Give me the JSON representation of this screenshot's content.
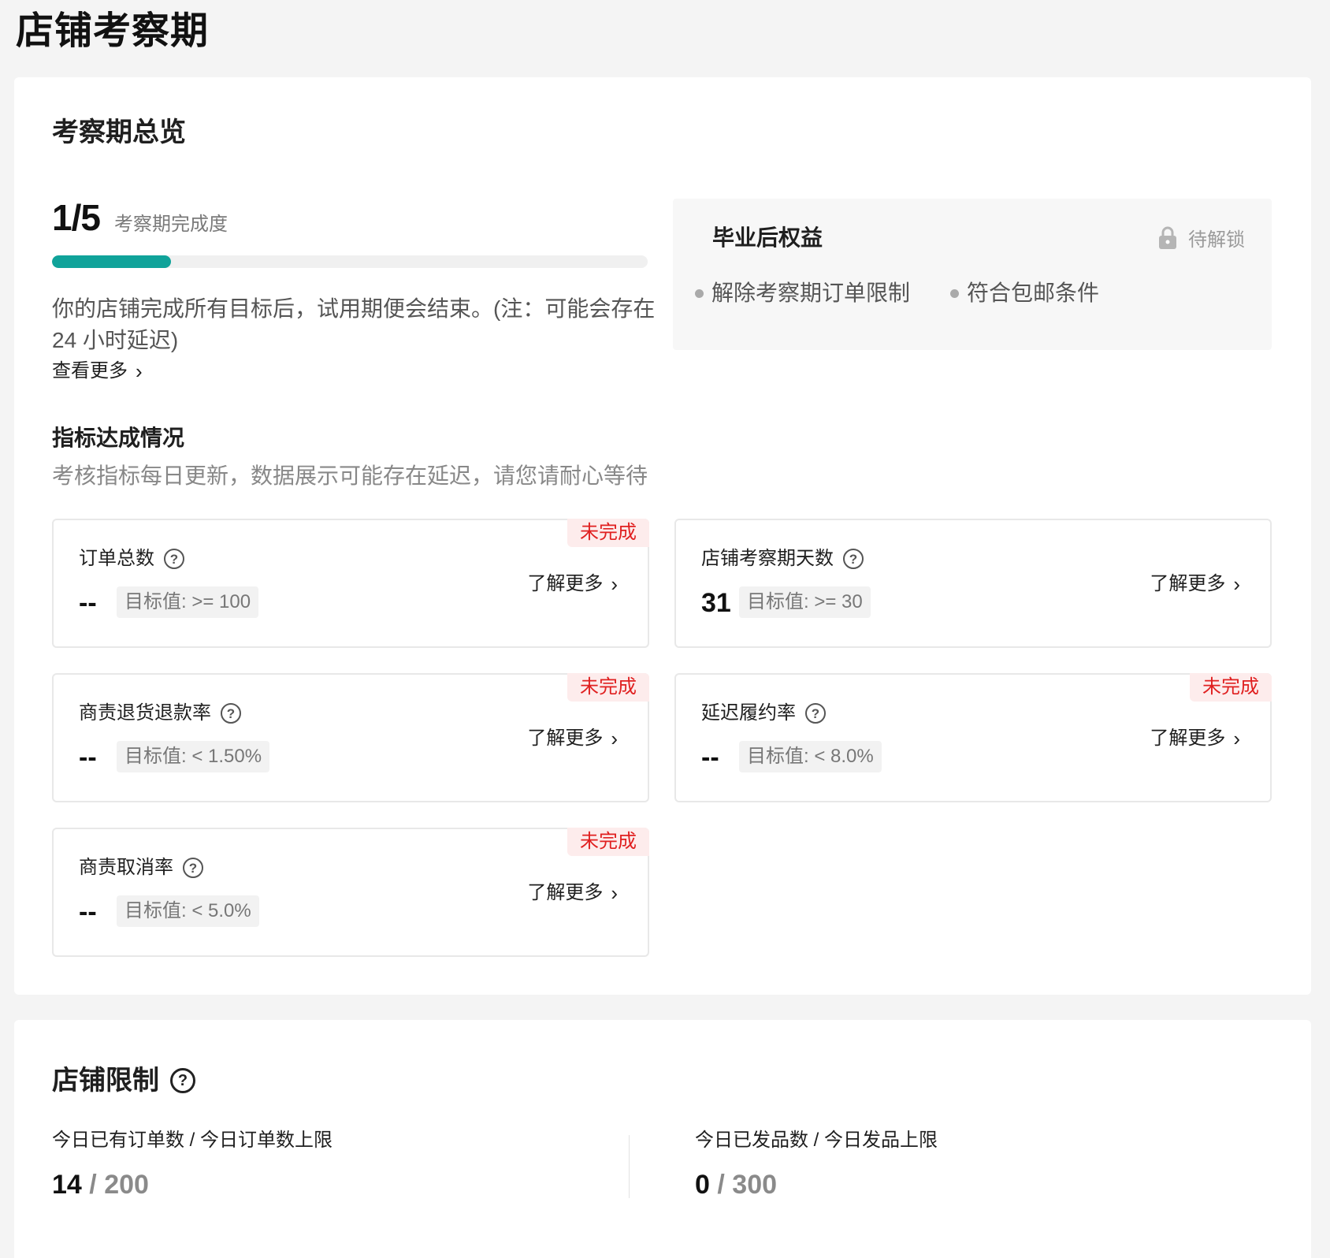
{
  "page": {
    "title": "店铺考察期"
  },
  "overview": {
    "section_title": "考察期总览",
    "progress": {
      "value_text": "1/5",
      "label": "考察期完成度",
      "completed": 1,
      "total": 5,
      "fill_color": "#10a39a"
    },
    "note": "你的店铺完成所有目标后，试用期便会结束。(注：可能会存在 24 小时延迟)",
    "see_more": "查看更多",
    "benefits": {
      "title": "毕业后权益",
      "lock_label": "待解锁",
      "items": [
        "解除考察期订单限制",
        "符合包邮条件"
      ]
    }
  },
  "metrics": {
    "title": "指标达成情况",
    "subtitle": "考核指标每日更新，数据展示可能存在延迟，请您请耐心等待",
    "learn_more": "了解更多",
    "badge_incomplete": "未完成",
    "items": [
      {
        "name": "订单总数",
        "value": "--",
        "target": "目标值: >= 100",
        "incomplete": true
      },
      {
        "name": "店铺考察期天数",
        "value": "31",
        "target": "目标值: >= 30",
        "incomplete": false
      },
      {
        "name": "商责退货退款率",
        "value": "--",
        "target": "目标值: < 1.50%",
        "incomplete": true
      },
      {
        "name": "延迟履约率",
        "value": "--",
        "target": "目标值: < 8.0%",
        "incomplete": true
      },
      {
        "name": "商责取消率",
        "value": "--",
        "target": "目标值: < 5.0%",
        "incomplete": true
      }
    ]
  },
  "limits": {
    "title": "店铺限制",
    "orders": {
      "label": "今日已有订单数 / 今日订单数上限",
      "current": "14",
      "separator": "/",
      "max": "200"
    },
    "shipments": {
      "label": "今日已发品数 / 今日发品上限",
      "current": "0",
      "separator": "/",
      "max": "300"
    }
  },
  "colors": {
    "accent": "#10a39a",
    "incomplete": "#e02020",
    "incomplete_bg": "#fdecec"
  }
}
